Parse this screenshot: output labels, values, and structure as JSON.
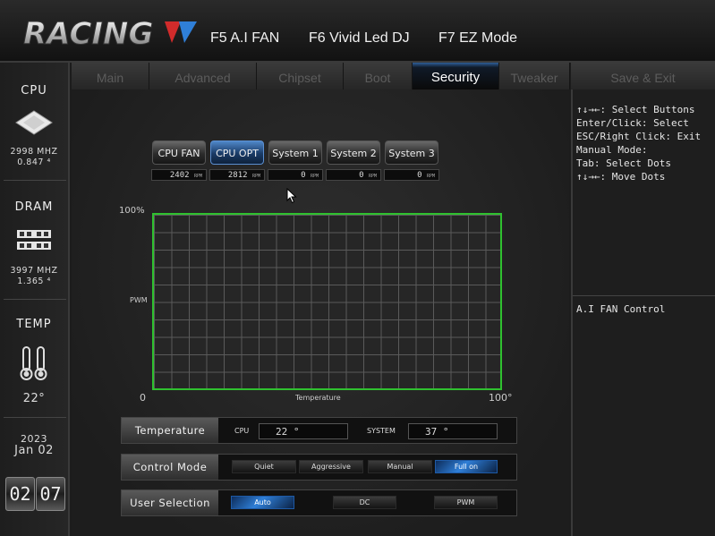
{
  "header": {
    "logo_text": "RACING",
    "fkeys": [
      "F5 A.I FAN",
      "F6 Vivid Led DJ",
      "F7 EZ Mode"
    ]
  },
  "left_panel": {
    "cpu": {
      "title": "CPU",
      "freq": "2998 MHZ",
      "volt": "0.847 ⁴"
    },
    "dram": {
      "title": "DRAM",
      "freq": "3997 MHZ",
      "volt": "1.365 ⁴"
    },
    "temp": {
      "title": "TEMP",
      "value": "22°"
    },
    "date": {
      "year": "2023",
      "month_day": "Jan 02"
    },
    "clock": {
      "h1": "02",
      "h2": "07"
    }
  },
  "tabs": [
    {
      "label": "Main",
      "active": false
    },
    {
      "label": "Advanced",
      "active": false
    },
    {
      "label": "Chipset",
      "active": false
    },
    {
      "label": "Boot",
      "active": false
    },
    {
      "label": "Security",
      "active": true
    },
    {
      "label": "Tweaker",
      "active": false
    },
    {
      "label": "Save & Exit",
      "active": false
    }
  ],
  "help": {
    "lines": [
      "↑↓→←: Select Buttons",
      "Enter/Click: Select",
      "ESC/Right Click: Exit",
      "Manual Mode:",
      "Tab: Select Dots",
      "↑↓→←: Move Dots"
    ],
    "section_title": "A.I FAN Control"
  },
  "fans": [
    {
      "label": "CPU FAN",
      "rpm": "2402",
      "selected": false
    },
    {
      "label": "CPU OPT",
      "rpm": "2812",
      "selected": true
    },
    {
      "label": "System 1",
      "rpm": "0",
      "selected": false
    },
    {
      "label": "System 2",
      "rpm": "0",
      "selected": false
    },
    {
      "label": "System 3",
      "rpm": "0",
      "selected": false
    }
  ],
  "rpm_unit": "RPM",
  "graph": {
    "y_max_label": "100%",
    "y_label": "PWM",
    "x_min_label": "0",
    "x_label": "Temperature",
    "x_max_label": "100°",
    "line_color": "#2fc12f"
  },
  "temperature_row": {
    "label": "Temperature",
    "cpu_label": "CPU",
    "cpu_value": "22 °",
    "system_label": "SYSTEM",
    "system_value": "37 °"
  },
  "control_mode_row": {
    "label": "Control Mode",
    "options": [
      {
        "label": "Quiet",
        "selected": false
      },
      {
        "label": "Aggressive",
        "selected": false
      },
      {
        "label": "Manual",
        "selected": false
      },
      {
        "label": "Full on",
        "selected": true
      }
    ]
  },
  "user_selection_row": {
    "label": "User Selection",
    "options": [
      {
        "label": "Auto",
        "selected": true
      },
      {
        "label": "DC",
        "selected": false
      },
      {
        "label": "PWM",
        "selected": false
      }
    ]
  },
  "colors": {
    "accent": "#2f7fd8",
    "graph_green": "#2fc12f"
  }
}
